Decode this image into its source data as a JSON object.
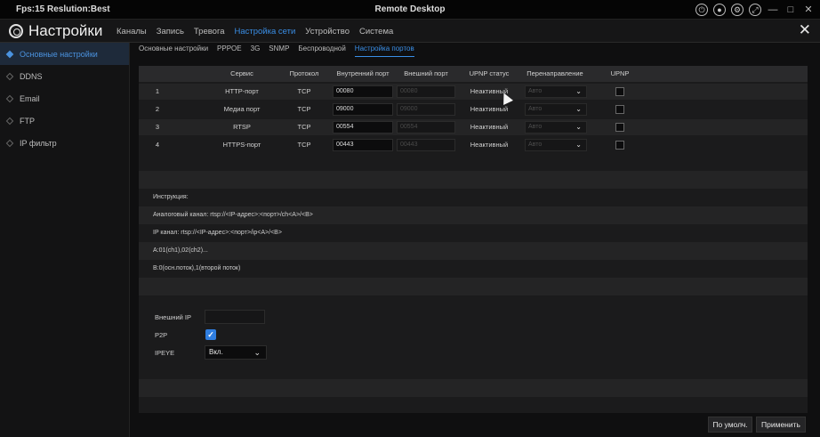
{
  "titlebar": {
    "left_text": "Fps:15 Reslution:Best",
    "center_text": "Remote Desktop",
    "icons": [
      "power-icon",
      "record-icon",
      "settings-icon",
      "fullscreen-icon"
    ],
    "minimize": "—",
    "maximize": "□",
    "close": "✕"
  },
  "menubar": {
    "title": "Настройки",
    "tabs": [
      "Каналы",
      "Запись",
      "Тревога",
      "Настройка сети",
      "Устройство",
      "Система"
    ],
    "active_tab": "Настройка сети",
    "close": "✕"
  },
  "sidebar": {
    "items": [
      "Основные настройки",
      "DDNS",
      "Email",
      "FTP",
      "IP фильтр"
    ],
    "active": 0
  },
  "subtabs": {
    "items": [
      "Основные настройки",
      "PPPOE",
      "3G",
      "SNMP",
      "Беспроводной",
      "Настройка портов"
    ],
    "active": 5
  },
  "ports_table": {
    "headers": [
      "Сервис",
      "Протокол",
      "Внутренний порт",
      "Внешний порт",
      "UPNP статус",
      "Перенаправление",
      "UPNP"
    ],
    "rows": [
      {
        "num": "1",
        "service": "HTTP-порт",
        "protocol": "TCP",
        "internal": "00080",
        "external": "00080",
        "status": "Неактивный",
        "redirect": "Авто"
      },
      {
        "num": "2",
        "service": "Медиа порт",
        "protocol": "TCP",
        "internal": "09000",
        "external": "09000",
        "status": "Неактивный",
        "redirect": "Авто"
      },
      {
        "num": "3",
        "service": "RTSP",
        "protocol": "TCP",
        "internal": "00554",
        "external": "00554",
        "status": "Неактивный",
        "redirect": "Авто"
      },
      {
        "num": "4",
        "service": "HTTPS-порт",
        "protocol": "TCP",
        "internal": "00443",
        "external": "00443",
        "status": "Неактивный",
        "redirect": "Авто"
      }
    ]
  },
  "instructions": {
    "title": "Инструкция:",
    "lines": [
      "Аналоговый канал: rtsp://<IP-адрес>:<порт>/ch<A>/<B>",
      "IP канал: rtsp://<IP-адрес>:<порт>/ip<A>/<B>",
      "A:01(ch1),02(ch2)...",
      "B:0(осн.поток),1(второй поток)"
    ]
  },
  "network": {
    "external_ip_label": "Внешний IP",
    "external_ip_value": "",
    "p2p_label": "P2P",
    "p2p_checked": true,
    "ipeye_label": "IPEYE",
    "ipeye_value": "Вкл."
  },
  "footer": {
    "default_button": "По умолч.",
    "apply_button": "Применить"
  },
  "colors": {
    "accent": "#3a8ee6",
    "background": "#0f0f10"
  }
}
